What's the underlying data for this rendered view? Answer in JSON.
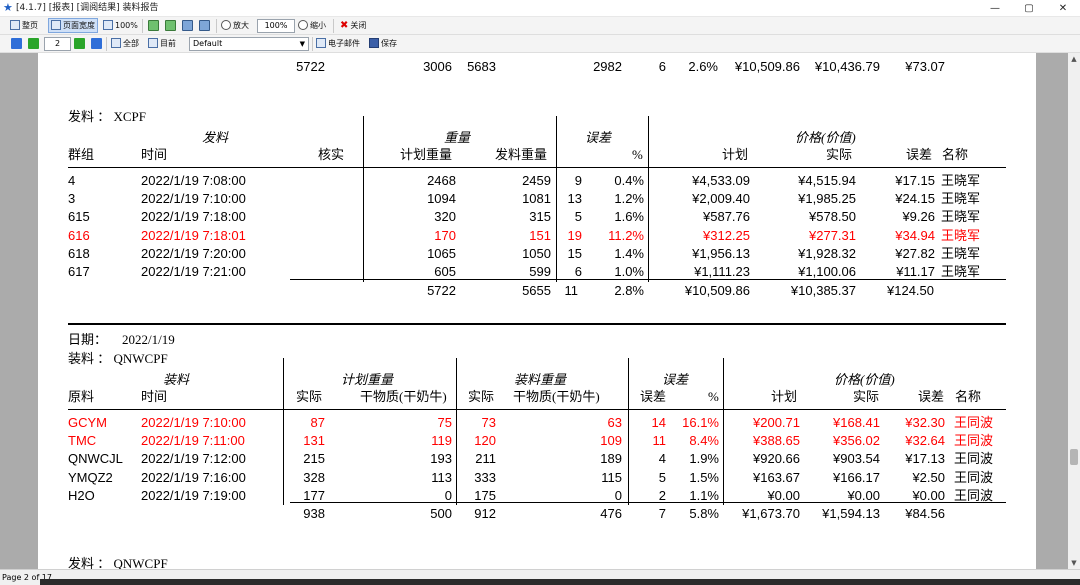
{
  "window": {
    "title": "[4.1.7] [报表] [调阅结果] 装料报告",
    "controls": [
      "—",
      "▢",
      "✕"
    ]
  },
  "toolbar1": [
    {
      "label": "整页",
      "icon": "page-icon"
    },
    {
      "label": "页面宽度",
      "icon": "page-width-icon"
    },
    {
      "label": "100%",
      "icon": "actual-size-icon"
    },
    {
      "label": "",
      "icon": "one-page-icon"
    },
    {
      "label": "",
      "icon": "two-page-icon"
    },
    {
      "label": "",
      "icon": "four-page-icon"
    },
    {
      "label": "",
      "icon": "multi-page-icon"
    },
    {
      "label": "放大",
      "icon": "zoom-in-icon"
    },
    {
      "label": "100%",
      "icon": "zoom-input"
    },
    {
      "label": "缩小",
      "icon": "zoom-out-icon"
    },
    {
      "label": "关闭",
      "icon": "close-icon"
    }
  ],
  "toolbar2": {
    "page_number": "2",
    "print_all": "全部",
    "print_current": "目前",
    "format_select": "Default",
    "email": "电子邮件",
    "save": "保存"
  },
  "status": {
    "page_text": "Page 2 of 17"
  },
  "report": {
    "top_total": [
      "5722",
      "3006",
      "5683",
      "2982",
      "6",
      "2.6%",
      "¥10,509.86",
      "¥10,436.79",
      "¥73.07"
    ],
    "section1": {
      "label": "发料 ： XCPF",
      "group_headers": [
        "发料",
        "重量",
        "误差",
        "价格(价值)"
      ],
      "col_headers": [
        "群组",
        "时间",
        "核实",
        "计划重量",
        "发料重量",
        "%",
        "计划",
        "实际",
        "误差",
        "名称"
      ],
      "rows": [
        {
          "c": [
            "4",
            "2022/1/19 7:08:00",
            "2468",
            "2459",
            "9",
            "0.4%",
            "¥4,533.09",
            "¥4,515.94",
            "¥17.15",
            "王晓军"
          ],
          "red": false
        },
        {
          "c": [
            "3",
            "2022/1/19 7:10:00",
            "1094",
            "1081",
            "13",
            "1.2%",
            "¥2,009.40",
            "¥1,985.25",
            "¥24.15",
            "王晓军"
          ],
          "red": false
        },
        {
          "c": [
            "615",
            "2022/1/19 7:18:00",
            "320",
            "315",
            "5",
            "1.6%",
            "¥587.76",
            "¥578.50",
            "¥9.26",
            "王晓军"
          ],
          "red": false
        },
        {
          "c": [
            "616",
            "2022/1/19 7:18:01",
            "170",
            "151",
            "19",
            "11.2%",
            "¥312.25",
            "¥277.31",
            "¥34.94",
            "王晓军"
          ],
          "red": true
        },
        {
          "c": [
            "618",
            "2022/1/19 7:20:00",
            "1065",
            "1050",
            "15",
            "1.4%",
            "¥1,956.13",
            "¥1,928.32",
            "¥27.82",
            "王晓军"
          ],
          "red": false
        },
        {
          "c": [
            "617",
            "2022/1/19 7:21:00",
            "605",
            "599",
            "6",
            "1.0%",
            "¥1,111.23",
            "¥1,100.06",
            "¥11.17",
            "王晓军"
          ],
          "red": false
        }
      ],
      "totals": [
        "5722",
        "5655",
        "11",
        "2.8%",
        "¥10,509.86",
        "¥10,385.37",
        "¥124.50"
      ]
    },
    "date_label": "日期：",
    "date_value": "2022/1/19",
    "section2": {
      "label": "装料 ： QNWCPF",
      "group_headers": [
        "装料",
        "计划重量",
        "装料重量",
        "误差",
        "价格(价值)"
      ],
      "col_headers": [
        "原料",
        "时间",
        "实际",
        "干物质(干奶牛)",
        "实际",
        "干物质(干奶牛)",
        "误差",
        "%",
        "计划",
        "实际",
        "误差",
        "名称"
      ],
      "rows": [
        {
          "c": [
            "GCYM",
            "2022/1/19 7:10:00",
            "87",
            "75",
            "73",
            "63",
            "14",
            "16.1%",
            "¥200.71",
            "¥168.41",
            "¥32.30",
            "王同波"
          ],
          "red": true
        },
        {
          "c": [
            "TMC",
            "2022/1/19 7:11:00",
            "131",
            "119",
            "120",
            "109",
            "11",
            "8.4%",
            "¥388.65",
            "¥356.02",
            "¥32.64",
            "王同波"
          ],
          "red": true
        },
        {
          "c": [
            "QNWCJL",
            "2022/1/19 7:12:00",
            "215",
            "193",
            "211",
            "189",
            "4",
            "1.9%",
            "¥920.66",
            "¥903.54",
            "¥17.13",
            "王同波"
          ],
          "red": false
        },
        {
          "c": [
            "YMQZ2",
            "2022/1/19 7:16:00",
            "328",
            "113",
            "333",
            "115",
            "5",
            "1.5%",
            "¥163.67",
            "¥166.17",
            "¥2.50",
            "王同波"
          ],
          "red": false
        },
        {
          "c": [
            "H2O",
            "2022/1/19 7:19:00",
            "177",
            "0",
            "175",
            "0",
            "2",
            "1.1%",
            "¥0.00",
            "¥0.00",
            "¥0.00",
            "王同波"
          ],
          "red": false
        }
      ],
      "totals": [
        "938",
        "500",
        "912",
        "476",
        "7",
        "5.8%",
        "¥1,673.70",
        "¥1,594.13",
        "¥84.56"
      ]
    },
    "next_label": "发料 ： QNWCPF"
  }
}
